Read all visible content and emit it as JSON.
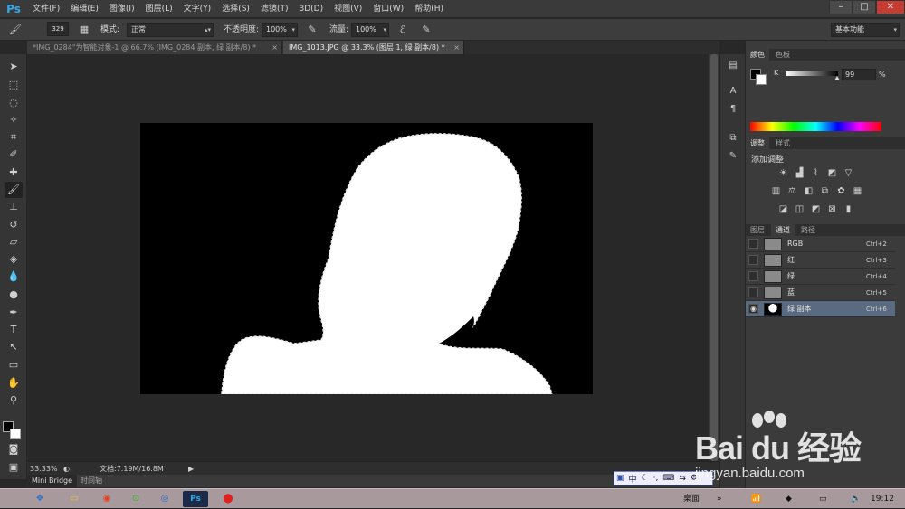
{
  "app": {
    "logo": "Ps"
  },
  "menu": [
    "文件(F)",
    "编辑(E)",
    "图像(I)",
    "图层(L)",
    "文字(Y)",
    "选择(S)",
    "滤镜(T)",
    "3D(D)",
    "视图(V)",
    "窗口(W)",
    "帮助(H)"
  ],
  "window_controls": {
    "minimize": "–",
    "maximize": "□",
    "close": "✕"
  },
  "options": {
    "brush_size": "329",
    "mode_label": "模式:",
    "mode_value": "正常",
    "opacity_label": "不透明度:",
    "opacity_value": "100%",
    "flow_label": "流量:",
    "flow_value": "100%",
    "workspace": "基本功能"
  },
  "tabs": [
    {
      "label": "*IMG_0284\"为智能对象-1 @ 66.7% (IMG_0284 副本, 绿 副本/8) *",
      "close": "×"
    },
    {
      "label": "IMG_1013.JPG @ 33.3% (图层 1, 绿 副本/8) *",
      "close": "×"
    }
  ],
  "status": {
    "zoom": "33.33%",
    "doc": "文档:7.19M/16.8M"
  },
  "bottom_tabs": [
    "Mini Bridge",
    "时间轴"
  ],
  "color_panel": {
    "tabs": [
      "颜色",
      "色板"
    ],
    "channel_label": "K",
    "value": "99",
    "unit": "%",
    "level": 0.99
  },
  "adjust_panel": {
    "tabs": [
      "调整",
      "样式"
    ],
    "title": "添加调整",
    "icons_row1": [
      "brightness-icon",
      "levels-icon",
      "curves-icon",
      "exposure-icon",
      "vibrance-icon"
    ],
    "icons_row2": [
      "hue-saturation-icon",
      "color-balance-icon",
      "black-white-icon",
      "photo-filter-icon",
      "channel-mixer-icon",
      "color-lookup-icon"
    ],
    "icons_row3": [
      "invert-icon",
      "posterize-icon",
      "threshold-icon",
      "selective-color-icon",
      "gradient-map-icon"
    ]
  },
  "channels_panel": {
    "tabs": [
      "图层",
      "通道",
      "路径"
    ],
    "rows": [
      {
        "name": "RGB",
        "key": "Ctrl+2",
        "visible": false,
        "selected": false
      },
      {
        "name": "红",
        "key": "Ctrl+3",
        "visible": false,
        "selected": false
      },
      {
        "name": "绿",
        "key": "Ctrl+4",
        "visible": false,
        "selected": false
      },
      {
        "name": "蓝",
        "key": "Ctrl+5",
        "visible": false,
        "selected": false
      },
      {
        "name": "绿 副本",
        "key": "Ctrl+6",
        "visible": true,
        "selected": true
      }
    ]
  },
  "ime": [
    "中",
    "☾",
    "·,",
    "⌨",
    "⇆",
    "⚙"
  ],
  "taskbar": {
    "desktop_label": "桌面",
    "time": "19:12",
    "apps": [
      "start-orb-icon",
      "explorer-icon",
      "media-icon",
      "browser-360-icon",
      "chrome-icon",
      "photoshop-icon",
      "app-red-icon"
    ]
  },
  "watermark": {
    "text": "Bai du 经验",
    "url": "jingyan.baidu.com"
  },
  "colors": {
    "accent": "#35a9e8",
    "selection": "#5a6a80",
    "panel": "#3b3b3b",
    "canvas": "#282828"
  }
}
